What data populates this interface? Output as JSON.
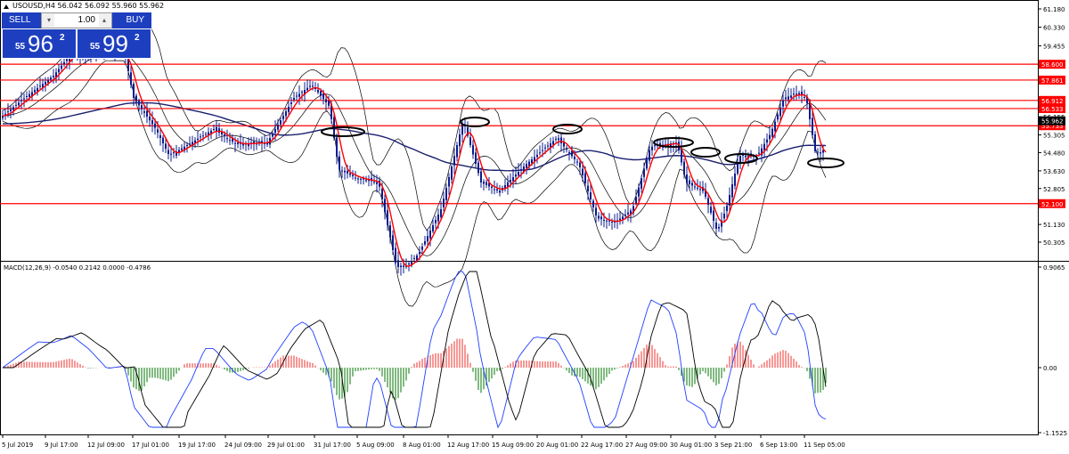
{
  "header": {
    "symbol_title": "USOUSD,H4  56.042 56.092 55.960 55.962"
  },
  "trade_panel": {
    "sell_label": "SELL",
    "buy_label": "BUY",
    "lot": "1.00",
    "sell_price": {
      "small": "55",
      "big": "96",
      "sup": "2"
    },
    "buy_price": {
      "small": "55",
      "big": "99",
      "sup": "2"
    }
  },
  "price_axis": {
    "labels": [
      "61.180",
      "60.330",
      "59.455",
      "58.600",
      "57.861",
      "56.912",
      "56.533",
      "56.155",
      "55.962",
      "55.733",
      "55.305",
      "54.480",
      "53.630",
      "52.805",
      "52.100",
      "51.130",
      "50.305"
    ]
  },
  "horizontal_lines": [
    {
      "price": 58.6,
      "label": "58.600"
    },
    {
      "price": 57.861,
      "label": "57.861"
    },
    {
      "price": 56.912,
      "label": "56.912"
    },
    {
      "price": 56.533,
      "label": "56.533"
    },
    {
      "price": 55.733,
      "label": "55.733"
    },
    {
      "price": 52.1,
      "label": "52.100"
    }
  ],
  "current_price": {
    "price": 55.962,
    "label": "55.962"
  },
  "macd": {
    "title": "MACD(12,26,9) -0.0540 0.2142 0.0000 -0.4786",
    "axis_labels": [
      "0.9065",
      "0.00",
      "-1.1525"
    ]
  },
  "time_axis": {
    "labels": [
      "5 Jul 2019",
      "9 Jul 17:00",
      "12 Jul 09:00",
      "17 Jul 01:00",
      "19 Jul 17:00",
      "24 Jul 09:00",
      "29 Jul 01:00",
      "31 Jul 17:00",
      "5 Aug 09:00",
      "8 Aug 01:00",
      "12 Aug 17:00",
      "15 Aug 09:00",
      "20 Aug 01:00",
      "22 Aug 17:00",
      "27 Aug 09:00",
      "30 Aug 01:00",
      "3 Sep 21:00",
      "6 Sep 13:00",
      "11 Sep 05:00"
    ]
  },
  "colors": {
    "level_line": "#ff0000",
    "candle": "#0b1c8c",
    "ma_red": "#ff0000",
    "ma_long": "#1a1f6e",
    "bollinger": "#000000",
    "hist_pos": "#ef5350",
    "hist_neg": "#2e8b2e",
    "macd_blue": "#1f3fff",
    "macd_black": "#000000",
    "panel_blue": "#1d3fbf"
  },
  "icons": {
    "collapse": "triangle-up-icon",
    "lot_down": "arrow-down-icon",
    "lot_up": "arrow-up-icon"
  }
}
